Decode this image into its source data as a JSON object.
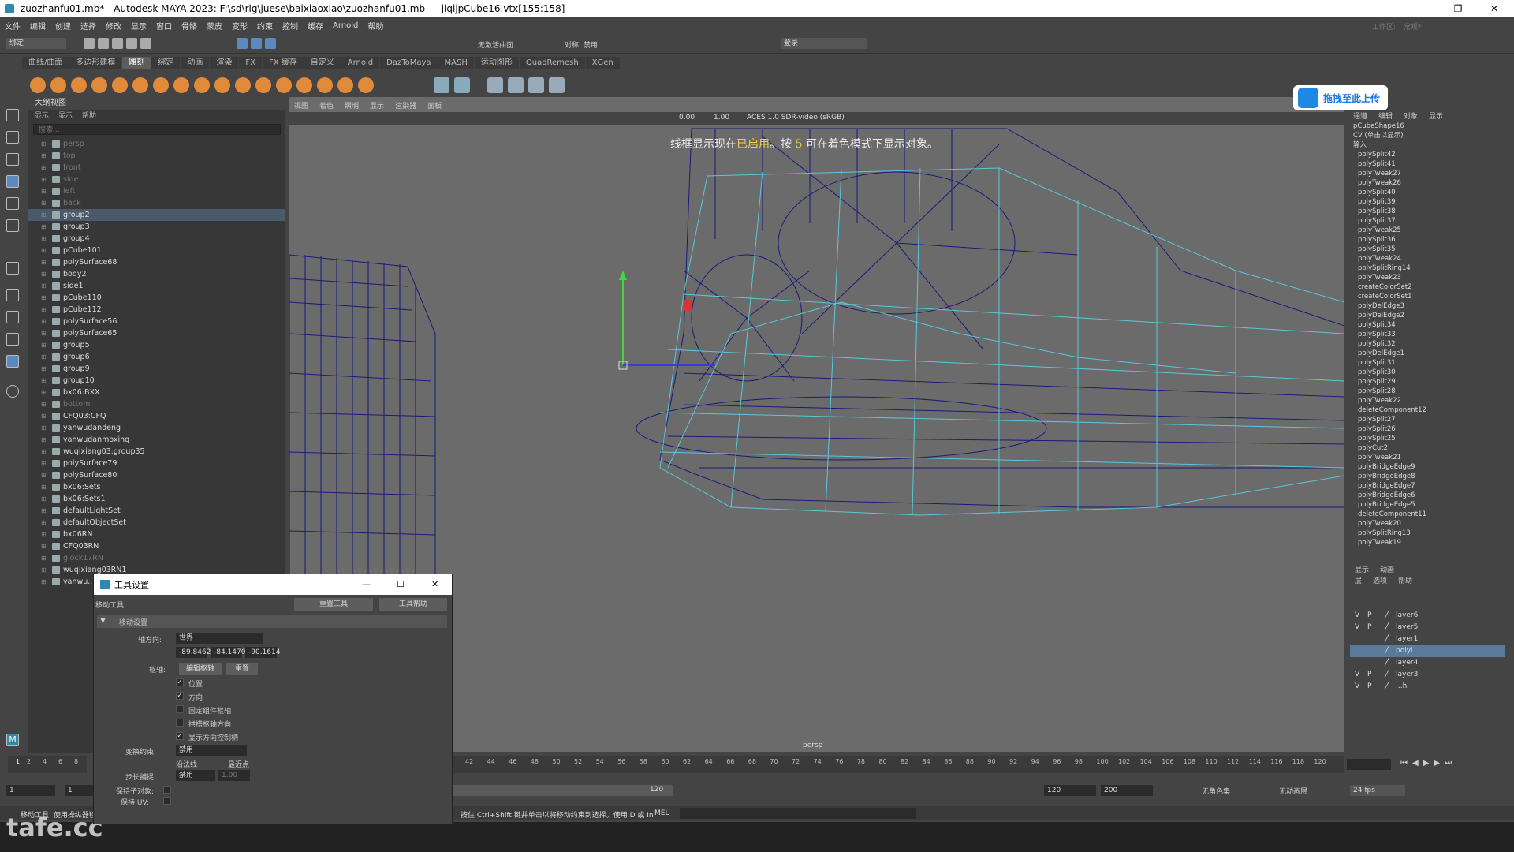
{
  "window": {
    "title": "zuozhanfu01.mb* - Autodesk MAYA 2023: F:\\sd\\rig\\juese\\baixiaoxiao\\zuozhanfu01.mb  ---  jiqijpCube16.vtx[155:158]"
  },
  "menubar": [
    "文件",
    "编辑",
    "创建",
    "选择",
    "修改",
    "显示",
    "窗口",
    "骨骼",
    "蒙皮",
    "变形",
    "约束",
    "控制",
    "缓存",
    "Arnold",
    "帮助"
  ],
  "toolbar": {
    "mode": "绑定",
    "symmetry_label": "无激活曲面",
    "symmetry2": "对称: 禁用",
    "login": "登录",
    "workspace_label": "工作区:",
    "workspace_value": "常规*"
  },
  "shelf_tabs": [
    "曲线/曲面",
    "多边形建模",
    "雕刻",
    "绑定",
    "动画",
    "渲染",
    "FX",
    "FX 缓存",
    "自定义",
    "Arnold",
    "DazToMaya",
    "MASH",
    "运动图形",
    "QuadRemesh",
    "XGen"
  ],
  "shelf_active": 2,
  "outliner": {
    "title": "大纲视图",
    "menu": [
      "显示",
      "显示",
      "帮助"
    ],
    "search_placeholder": "搜索...",
    "items": [
      {
        "label": "persp",
        "dim": true
      },
      {
        "label": "top",
        "dim": true
      },
      {
        "label": "front",
        "dim": true
      },
      {
        "label": "side",
        "dim": true
      },
      {
        "label": "left",
        "dim": true
      },
      {
        "label": "back",
        "dim": true
      },
      {
        "label": "group2",
        "sel": true
      },
      {
        "label": "group3"
      },
      {
        "label": "group4"
      },
      {
        "label": "pCube101"
      },
      {
        "label": "polySurface68"
      },
      {
        "label": "body2"
      },
      {
        "label": "side1"
      },
      {
        "label": "pCube110"
      },
      {
        "label": "pCube112"
      },
      {
        "label": "polySurface56"
      },
      {
        "label": "polySurface65"
      },
      {
        "label": "group5"
      },
      {
        "label": "group6"
      },
      {
        "label": "group9"
      },
      {
        "label": "group10"
      },
      {
        "label": "bx06:BXX"
      },
      {
        "label": "bottom",
        "dim": true
      },
      {
        "label": "CFQ03:CFQ"
      },
      {
        "label": "yanwudandeng"
      },
      {
        "label": "yanwudanmoxing"
      },
      {
        "label": "wuqixiang03:group35"
      },
      {
        "label": "polySurface79"
      },
      {
        "label": "polySurface80"
      },
      {
        "label": "bx06:Sets"
      },
      {
        "label": "bx06:Sets1"
      },
      {
        "label": "defaultLightSet"
      },
      {
        "label": "defaultObjectSet"
      },
      {
        "label": "bx06RN"
      },
      {
        "label": "CFQ03RN"
      },
      {
        "label": "glock17RN",
        "dim": true
      },
      {
        "label": "wuqixiang03RN1"
      },
      {
        "label": "yanwu..."
      }
    ]
  },
  "viewport": {
    "menu": [
      "视图",
      "着色",
      "照明",
      "显示",
      "渲染器",
      "面板"
    ],
    "exposure": "0.00",
    "gamma": "1.00",
    "colorspace": "ACES 1.0 SDR-video (sRGB)",
    "hud_pre": "线框显示现在",
    "hud_hl1": "已启用",
    "hud_mid": "。按 ",
    "hud_hl2": "5",
    "hud_post": " 可在着色模式下显示对象。",
    "camera": "persp"
  },
  "upload_button": "拖拽至此上传",
  "channel_box": {
    "tabs": [
      "通道",
      "编辑",
      "对象",
      "显示"
    ],
    "node": "pCubeShape16",
    "cv": "CV (单击以显示)",
    "inputs_label": "输入",
    "inputs": [
      "polySplit42",
      "polySplit41",
      "polyTweak27",
      "polyTweak26",
      "polySplit40",
      "polySplit39",
      "polySplit38",
      "polySplit37",
      "polyTweak25",
      "polySplit36",
      "polySplit35",
      "polyTweak24",
      "polySplitRing14",
      "polyTweak23",
      "createColorSet2",
      "createColorSet1",
      "polyDelEdge3",
      "polyDelEdge2",
      "polySplit34",
      "polySplit33",
      "polySplit32",
      "polyDelEdge1",
      "polySplit31",
      "polySplit30",
      "polySplit29",
      "polySplit28",
      "polyTweak22",
      "deleteComponent12",
      "polySplit27",
      "polySplit26",
      "polySplit25",
      "polyCut2",
      "polyTweak21",
      "polyBridgeEdge9",
      "polyBridgeEdge8",
      "polyBridgeEdge7",
      "polyBridgeEdge6",
      "polyBridgeEdge5",
      "deleteComponent11",
      "polyTweak20",
      "polySplitRing13",
      "polyTweak19"
    ]
  },
  "layers": {
    "tabs": [
      "显示",
      "动画"
    ],
    "menu": [
      "层",
      "选项",
      "帮助"
    ],
    "rows": [
      {
        "v": "V",
        "p": "P",
        "name": "layer6"
      },
      {
        "v": "V",
        "p": "P",
        "name": "layer5"
      },
      {
        "v": "",
        "p": "",
        "name": "layer1"
      },
      {
        "v": "",
        "p": "",
        "name": "polyl",
        "sel": true
      },
      {
        "v": "",
        "p": "",
        "name": "layer4"
      },
      {
        "v": "V",
        "p": "P",
        "name": "layer3"
      },
      {
        "v": "V",
        "p": "P",
        "name": "...hi"
      }
    ]
  },
  "timeline": {
    "ticks": [
      "42",
      "44",
      "46",
      "48",
      "50",
      "52",
      "54",
      "56",
      "58",
      "60",
      "62",
      "64",
      "66",
      "68",
      "70",
      "72",
      "74",
      "76",
      "78",
      "80",
      "82",
      "84",
      "86",
      "88",
      "90",
      "92",
      "94",
      "96",
      "98",
      "100",
      "102",
      "104",
      "106",
      "108",
      "110",
      "112",
      "114",
      "116",
      "118",
      "120"
    ],
    "left_ticks": [
      "2",
      "4",
      "6",
      "8"
    ],
    "current": "1"
  },
  "range": {
    "start": "1",
    "start2": "1",
    "end_slider": "120",
    "end": "120",
    "end2": "200",
    "character": "无角色集",
    "anim_layer": "无动画层",
    "fps": "24 fps"
  },
  "cmdline": {
    "status_left": "移动工具: 使用操纵器移…",
    "help_line": "按住 Ctrl+Shift 键并单击以将移动约束到选择。使用 D 或 In",
    "lang": "MEL"
  },
  "watermark": "tafe.cc",
  "tool_settings": {
    "title": "工具设置",
    "tool_name": "移动工具",
    "reset_button": "重置工具",
    "help_button": "工具帮助",
    "section": "移动设置",
    "axis_label": "轴方向:",
    "axis_value": "世界",
    "xyz": [
      "-89.8462",
      "-84.1470",
      "-90.1614"
    ],
    "pivot_label": "枢轴:",
    "edit_pivot": "编辑枢轴",
    "reset_pivot": "重置",
    "checks": [
      {
        "label": "位置",
        "on": true
      },
      {
        "label": "方向",
        "on": true
      },
      {
        "label": "固定组件枢轴",
        "on": false
      },
      {
        "label": "拱搭枢轴方向",
        "on": false
      },
      {
        "label": "显示方向控制柄",
        "on": true
      }
    ],
    "constraint_label": "变换约束:",
    "constraint_value": "禁用",
    "edge_label": "沿法线",
    "nearest_label": "最近点",
    "step_label": "步长捕捉:",
    "step_value": "禁用",
    "step_num": "1.00",
    "preserve_child": "保持子对象:",
    "preserve_uv": "保持 UV:"
  }
}
